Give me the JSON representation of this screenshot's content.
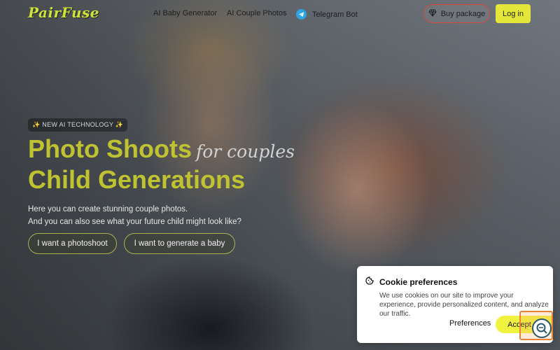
{
  "header": {
    "logo": "PairFuse",
    "nav": {
      "baby": "AI Baby Generator",
      "couple": "AI Couple Photos",
      "telegram": "Telegram Bot"
    },
    "buy_label": "Buy package",
    "login_label": "Log in"
  },
  "hero": {
    "badge": "✨ NEW AI TECHNOLOGY ✨",
    "headline_1": "Photo Shoots",
    "headline_script": "for couples",
    "headline_2": "Child Generations",
    "sub_1": "Here you can create stunning couple photos.",
    "sub_2": "And you can also see what your future child might look like?",
    "cta_photo": "I want a photoshoot",
    "cta_baby": "I want to generate a baby"
  },
  "cookie": {
    "title": "Cookie preferences",
    "text": "We use cookies on our site to improve your experience, provide personalized content, and analyze our traffic.",
    "preferences": "Preferences",
    "accept": "Accept all"
  },
  "colors": {
    "accent": "#bfc231",
    "login_bg": "#e4e73a",
    "buy_border": "#d9463a",
    "telegram": "#2ca5e0"
  }
}
